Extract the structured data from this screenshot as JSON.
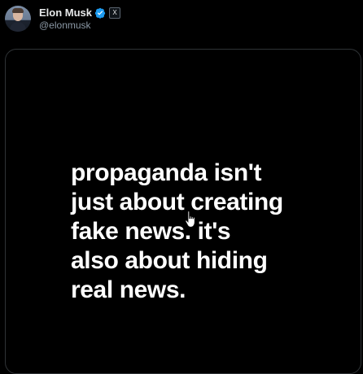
{
  "tweet": {
    "author": {
      "display_name": "Elon Musk",
      "handle": "@elonmusk",
      "verified": true,
      "affiliate_badge": "X"
    },
    "media": {
      "text": "propaganda isn't\njust about creating\nfake news. it's\nalso about hiding\nreal news."
    }
  },
  "colors": {
    "background": "#000000",
    "verified": "#1d9bf0",
    "handle": "#8b98a5",
    "card_border": "#2f3336"
  },
  "icons": {
    "verified": "verified-badge-icon",
    "affiliate": "x-logo-icon",
    "cursor": "hand-cursor-icon"
  }
}
